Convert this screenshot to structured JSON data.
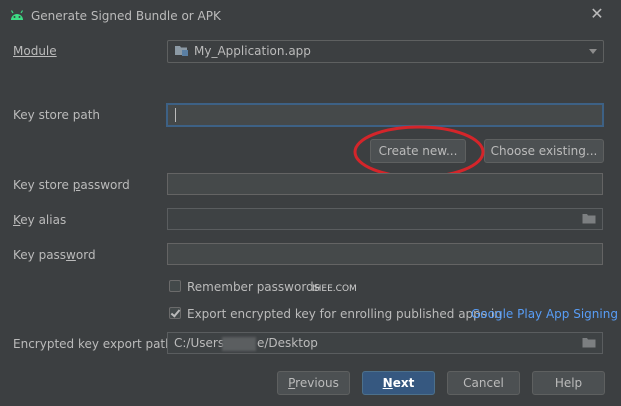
{
  "window": {
    "title": "Generate Signed Bundle or APK",
    "close_icon": "close-icon",
    "app_icon": "android-icon"
  },
  "module": {
    "label": "Module",
    "value": "My_Application.app"
  },
  "key_store_path": {
    "label": "Key store path",
    "value": ""
  },
  "buttons": {
    "create_new": "Create new...",
    "choose_existing": "Choose existing...",
    "previous": "Previous",
    "next": "Next",
    "cancel": "Cancel",
    "help": "Help"
  },
  "key_store_password": {
    "label": "Key store password",
    "value": ""
  },
  "key_alias": {
    "label": "Key alias",
    "value": ""
  },
  "key_password": {
    "label": "Key password",
    "value": ""
  },
  "remember_passwords": {
    "label": "Remember passwords",
    "checked": false
  },
  "watermark": "IHEE.COM",
  "export_key": {
    "label": "Export encrypted key for enrolling published apps in",
    "link": "Google Play App Signing",
    "checked": true
  },
  "encrypted_export_path": {
    "label": "Encrypted key export path",
    "value_prefix": "C:/Users",
    "value_suffix": "e/Desktop"
  },
  "colors": {
    "background": "#3c3f41",
    "link": "#589df6",
    "primary_button": "#365880",
    "annotation": "#d4252a"
  }
}
